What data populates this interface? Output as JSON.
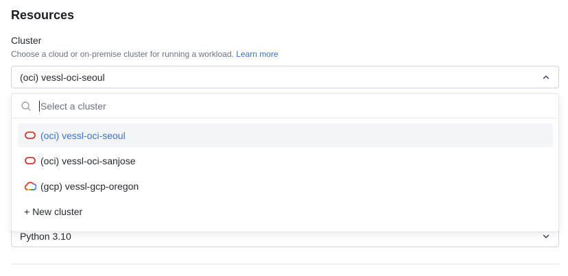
{
  "section": {
    "title": "Resources"
  },
  "cluster": {
    "label": "Cluster",
    "help_text": "Choose a cloud or on-premise cluster for running a workload.",
    "learn_more": "Learn more",
    "selected": "(oci) vessl-oci-seoul",
    "search_placeholder": "Select a cluster",
    "options": [
      {
        "label": "(oci) vessl-oci-seoul",
        "icon": "oracle-cloud-icon",
        "selected": true
      },
      {
        "label": "(oci) vessl-oci-sanjose",
        "icon": "oracle-cloud-icon",
        "selected": false
      },
      {
        "label": "(gcp) vessl-gcp-oregon",
        "icon": "google-cloud-icon",
        "selected": false
      }
    ],
    "new_cluster": "+ New cluster"
  },
  "python": {
    "selected": "Python 3.10"
  },
  "colors": {
    "accent": "#3b6fd8",
    "oracle_red": "#d9362b",
    "selected_bg": "#f3f5f9"
  }
}
